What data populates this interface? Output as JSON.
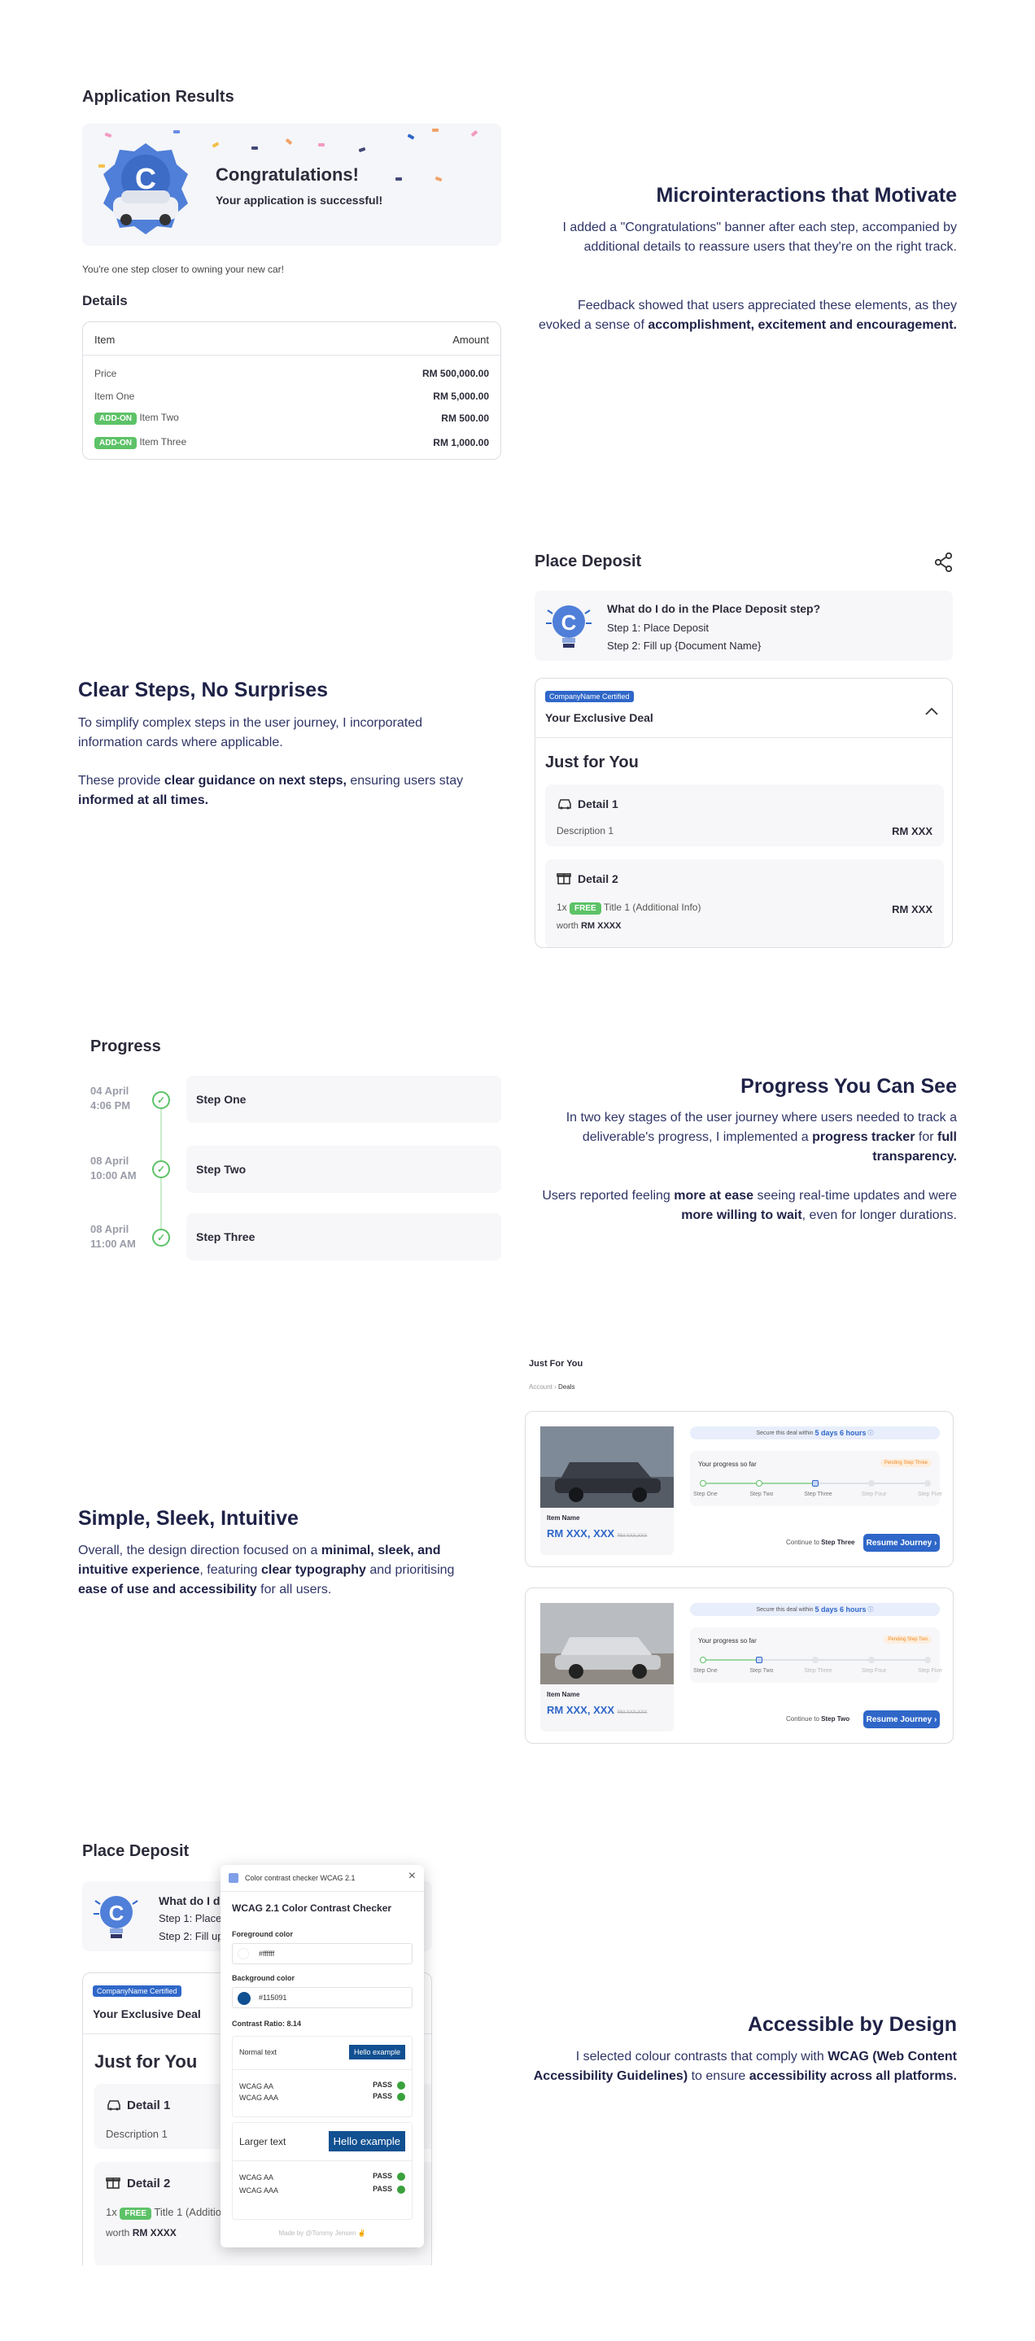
{
  "section1": {
    "panel_title": "Application Results",
    "congrats_title": "Congratulations!",
    "congrats_sub": "Your application is successful!",
    "closer_text": "You're one step closer to owning your new car!",
    "details_title": "Details",
    "table_header": {
      "item": "Item",
      "amount": "Amount"
    },
    "rows": [
      {
        "tag": "",
        "label": "Price",
        "amount": "RM 500,000.00"
      },
      {
        "tag": "",
        "label": "Item One",
        "amount": "RM 5,000.00"
      },
      {
        "tag": "ADD-ON",
        "label": "Item Two",
        "amount": "RM 500.00"
      },
      {
        "tag": "ADD-ON",
        "label": "Item Three",
        "amount": "RM 1,000.00"
      }
    ],
    "heading": "Microinteractions that Motivate",
    "para1": "I added a \"Congratulations\" banner after each step, accompanied by additional details to reassure users that they're on the right track.",
    "para2_a": "Feedback showed that users appreciated these elements, as they evoked a sense of ",
    "para2_b": "accomplishment, excitement and encouragement."
  },
  "section2": {
    "heading": "Clear Steps, No Surprises",
    "para1": "To simplify complex steps in the user journey, I incorporated information cards where applicable.",
    "para2_a": "These provide ",
    "para2_b": "clear guidance on next steps,",
    "para2_c": " ensuring users stay ",
    "para2_d": "informed at all times.",
    "panel_title": "Place Deposit",
    "info_title": "What do I do in the Place Deposit step?",
    "info_step1": "Step 1: Place Deposit",
    "info_step2": "Step 2: Fill up {Document Name}",
    "certified": "CompanyName Certified",
    "deal_title": "Your Exclusive Deal",
    "just_for_you": "Just for You",
    "detail1_title": "Detail 1",
    "detail1_desc": "Description 1",
    "detail1_amount": "RM XXX",
    "detail2_title": "Detail 2",
    "detail2_qty": "1x",
    "free_tag": "FREE",
    "detail2_item": "Title 1 (Additional Info)",
    "detail2_worth": "worth",
    "detail2_worth_val": "RM XXXX",
    "detail2_amount": "RM XXX"
  },
  "section3": {
    "panel_title": "Progress",
    "steps": [
      {
        "date": "04 April",
        "time": "4:06 PM",
        "label": "Step One"
      },
      {
        "date": "08 April",
        "time": "10:00 AM",
        "label": "Step Two"
      },
      {
        "date": "08 April",
        "time": "11:00 AM",
        "label": "Step Three"
      }
    ],
    "heading": "Progress You Can See",
    "para1_a": "In two key stages of the user journey where users needed to track a deliverable's progress, I implemented a ",
    "para1_b": "progress tracker",
    "para1_c": " for ",
    "para1_d": "full transparency.",
    "para2_a": "Users reported feeling ",
    "para2_b": "more at ease",
    "para2_c": " seeing real-time updates and were ",
    "para2_d": "more willing to wait",
    "para2_e": ", even for longer durations."
  },
  "section4": {
    "heading": "Simple, Sleek, Intuitive",
    "para_a": "Overall, the design direction focused on a ",
    "para_b": "minimal, sleek, and intuitive experience",
    "para_c": ", featuring ",
    "para_d": "clear typography",
    "para_e": " and prioritising ",
    "para_f": "ease of use and accessibility",
    "para_g": " for all users.",
    "page_title": "Just For You",
    "crumb_1": "Account",
    "crumb_2": "Deals",
    "cards": [
      {
        "secure_pre": "Secure this deal within",
        "secure_val": "5 days 6 hours",
        "progress_label": "Your progress so far",
        "pending": "Pending Step Three",
        "item_name": "Item Name",
        "price": "RM XXX, XXX",
        "old_price": "RM XXX,XXX",
        "continue_pre": "Continue to",
        "continue_step": "Step Three",
        "button": "Resume Journey",
        "done": 3,
        "track": [
          "Step One",
          "Step Two",
          "Step Three",
          "Step Four",
          "Step Five"
        ]
      },
      {
        "secure_pre": "Secure this deal within",
        "secure_val": "5 days 6 hours",
        "progress_label": "Your progress so far",
        "pending": "Pending Step Two",
        "item_name": "Item Name",
        "price": "RM XXX, XXX",
        "old_price": "RM XXX,XXX",
        "continue_pre": "Continue to",
        "continue_step": "Step Two",
        "button": "Resume Journey",
        "done": 2,
        "track": [
          "Step One",
          "Step Two",
          "Step Three",
          "Step Four",
          "Step Five"
        ]
      }
    ]
  },
  "section5": {
    "panel_title": "Place Deposit",
    "info_title": "What do I d",
    "info_step1": "Step 1: Place",
    "info_step2": "Step 2: Fill up",
    "certified": "CompanyName Certified",
    "deal_title": "Your Exclusive Deal",
    "just_for_you": "Just for You",
    "detail1_title": "Detail 1",
    "detail1_desc": "Description 1",
    "detail2_title": "Detail 2",
    "detail2_qty": "1x",
    "free_tag": "FREE",
    "detail2_item": "Title 1 (Additio",
    "detail2_worth": "worth",
    "detail2_worth_val": "RM XXXX",
    "checker": {
      "window_title": "Color contrast checker WCAG 2.1",
      "title": "WCAG 2.1 Color Contrast Checker",
      "fg_label": "Foreground color",
      "fg_value": "#ffffff",
      "bg_label": "Background color",
      "bg_value": "#115091",
      "ratio": "Contrast Ratio: 8.14",
      "normal_text": "Normal text",
      "larger_text": "Larger text",
      "example": "Hello example",
      "aa": "WCAG AA",
      "aaa": "WCAG AAA",
      "pass": "PASS",
      "footer": "Made by @Tommy Jensen"
    },
    "heading": "Accessible by Design",
    "para_a": "I selected colour contrasts that comply with ",
    "para_b": "WCAG (Web Content Accessibility Guidelines)",
    "para_c": " to ensure ",
    "para_d": "accessibility across all platforms."
  },
  "colors": {
    "accent_blue": "#2f67c9",
    "green": "#5dc267",
    "navy": "#1f2247",
    "checker_bg": "#115091"
  }
}
